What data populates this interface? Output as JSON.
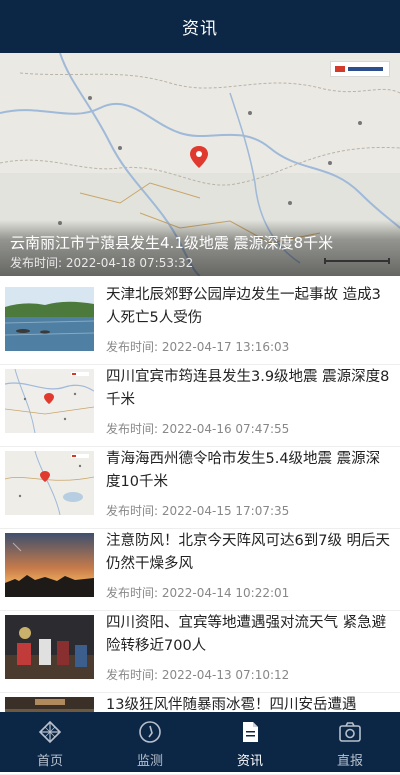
{
  "header": {
    "title": "资讯"
  },
  "hero": {
    "title": "云南丽江市宁蒗县发生4.1级地震 震源深度8千米",
    "time": "发布时间: 2022-04-18 07:53:32"
  },
  "news": [
    {
      "title": "天津北辰郊野公园岸边发生一起事故 造成3人死亡5人受伤",
      "time": "发布时间: 2022-04-17 13:16:03",
      "thumb": "lake-photo"
    },
    {
      "title": "四川宜宾市筠连县发生3.9级地震 震源深度8千米",
      "time": "发布时间: 2022-04-16 07:47:55",
      "thumb": "map"
    },
    {
      "title": "青海海西州德令哈市发生5.4级地震 震源深度10千米",
      "time": "发布时间: 2022-04-15 17:07:35",
      "thumb": "map"
    },
    {
      "title": "注意防风！北京今天阵风可达6到7级 明后天仍然干燥多风",
      "time": "发布时间: 2022-04-14 10:22:01",
      "thumb": "sunset-photo"
    },
    {
      "title": "四川资阳、宜宾等地遭遇强对流天气 紧急避险转移近700人",
      "time": "发布时间: 2022-04-13 07:10:12",
      "thumb": "rescue-photo"
    },
    {
      "title": "13级狂风伴随暴雨冰雹！四川安岳遭遇",
      "time": "",
      "thumb": "storm-photo"
    }
  ],
  "tabs": [
    {
      "label": "首页",
      "icon": "home-icon",
      "active": false
    },
    {
      "label": "监测",
      "icon": "monitor-icon",
      "active": false
    },
    {
      "label": "资讯",
      "icon": "news-icon",
      "active": true
    },
    {
      "label": "直报",
      "icon": "camera-icon",
      "active": false
    }
  ],
  "colors": {
    "header_bg": "#0c2746",
    "tab_active": "#ffffff",
    "tab_inactive": "#b7c0cc",
    "pin": "#e03a2e"
  }
}
